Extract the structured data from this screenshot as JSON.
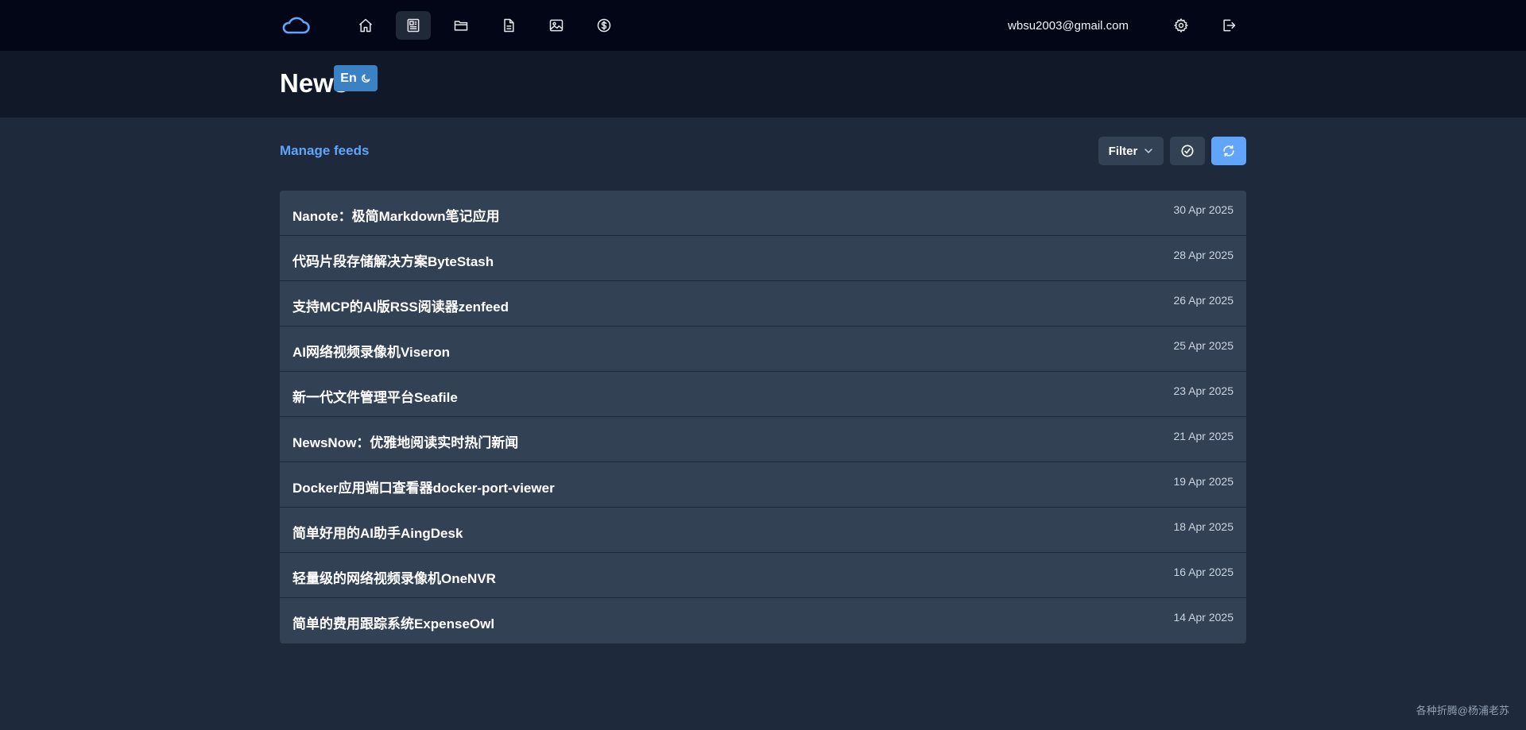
{
  "header": {
    "email": "wbsu2003@gmail.com",
    "nav": [
      {
        "name": "home-icon",
        "active": false
      },
      {
        "name": "news-icon",
        "active": true
      },
      {
        "name": "folder-icon",
        "active": false
      },
      {
        "name": "document-icon",
        "active": false
      },
      {
        "name": "image-icon",
        "active": false
      },
      {
        "name": "dollar-icon",
        "active": false
      }
    ]
  },
  "page": {
    "title": "News",
    "lang_label": "En"
  },
  "toolbar": {
    "manage_feeds": "Manage feeds",
    "filter_label": "Filter"
  },
  "feeds": [
    {
      "title": "Nanote：极简Markdown笔记应用",
      "date": "30 Apr 2025"
    },
    {
      "title": "代码片段存储解决方案ByteStash",
      "date": "28 Apr 2025"
    },
    {
      "title": "支持MCP的AI版RSS阅读器zenfeed",
      "date": "26 Apr 2025"
    },
    {
      "title": "AI网络视频录像机Viseron",
      "date": "25 Apr 2025"
    },
    {
      "title": "新一代文件管理平台Seafile",
      "date": "23 Apr 2025"
    },
    {
      "title": "NewsNow：优雅地阅读实时热门新闻",
      "date": "21 Apr 2025"
    },
    {
      "title": "Docker应用端口查看器docker-port-viewer",
      "date": "19 Apr 2025"
    },
    {
      "title": "简单好用的AI助手AingDesk",
      "date": "18 Apr 2025"
    },
    {
      "title": "轻量级的网络视频录像机OneNVR",
      "date": "16 Apr 2025"
    },
    {
      "title": "简单的费用跟踪系统ExpenseOwl",
      "date": "14 Apr 2025"
    }
  ],
  "watermark": "各种折腾@杨浦老苏",
  "colors": {
    "accent": "#60a5fa",
    "topbar": "#020617",
    "background": "#1e293b",
    "row": "#334155"
  }
}
